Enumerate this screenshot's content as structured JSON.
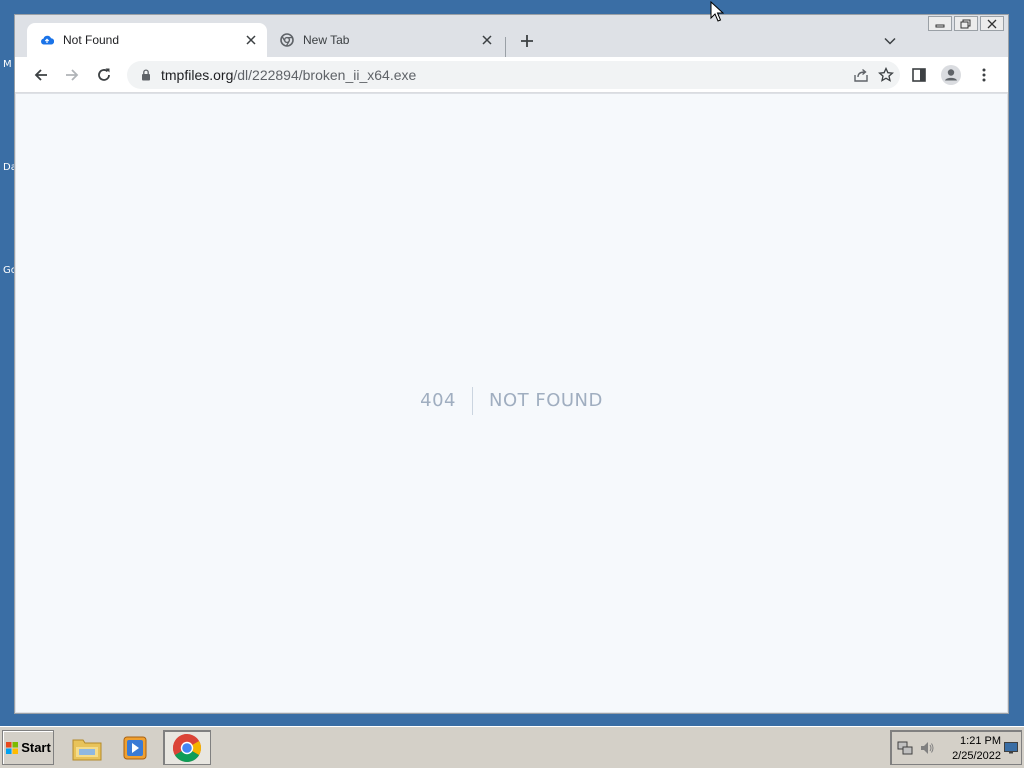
{
  "desktop": {
    "labels": [
      "M",
      "Da",
      "Go"
    ]
  },
  "browser": {
    "tabs": [
      {
        "title": "Not Found",
        "favicon": "cloud-upload-icon",
        "active": true
      },
      {
        "title": "New Tab",
        "favicon": "chrome-icon",
        "active": false
      }
    ],
    "address": {
      "host": "tmpfiles.org",
      "path": "/dl/222894/broken_ii_x64.exe"
    }
  },
  "page": {
    "error_code": "404",
    "error_message": "NOT FOUND"
  },
  "taskbar": {
    "start_label": "Start",
    "time": "1:21 PM",
    "date": "2/25/2022"
  },
  "colors": {
    "desktop": "#3a6ea5",
    "page_bg": "#f6f9fc",
    "error_text": "#a0aec0"
  }
}
